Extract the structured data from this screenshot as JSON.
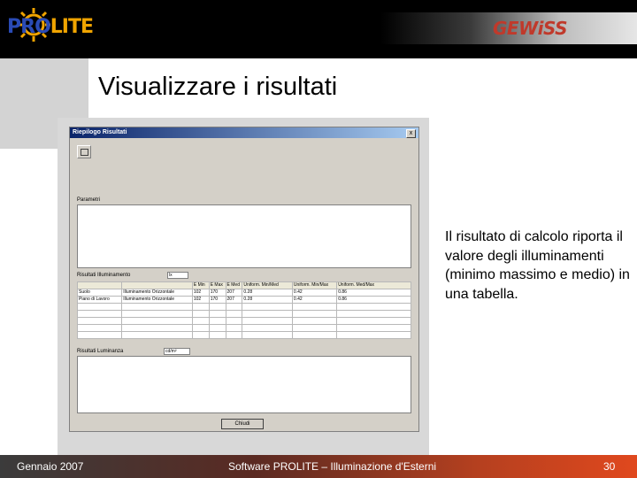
{
  "header": {
    "brand_left_pro": "PRO",
    "brand_left_lite": "LITE",
    "brand_right": "GEWiSS"
  },
  "slide": {
    "title": "Visualizzare i risultati",
    "description": "Il risultato di calcolo riporta il valore degli illuminamenti (minimo massimo e medio) in una tabella."
  },
  "window": {
    "title": "Riepilogo Risultati",
    "close_glyph": "x",
    "group1_label": "Parametri",
    "group2_label": "Risultati Illuminamento",
    "group2_field": "lx",
    "group3_label": "Risultati Luminanza",
    "group3_field": "cd/m²",
    "close_button": "Chiudi",
    "table": {
      "headers": [
        "",
        "",
        "E Min",
        "E Max",
        "E Med",
        "Uniform. Min/Med",
        "Uniform. Min/Max",
        "Uniform. Med/Max"
      ],
      "rows": [
        [
          "Suolo",
          "Illuminamento Orizzontale",
          "102",
          "170",
          "207",
          "0.28",
          "0.42",
          "0.86"
        ],
        [
          "Piano di Lavoro",
          "Illuminamento Orizzontale",
          "102",
          "170",
          "207",
          "0.28",
          "0.42",
          "0.86"
        ]
      ]
    }
  },
  "footer": {
    "date": "Gennaio 2007",
    "center": "Software PROLITE – Illuminazione d'Esterni",
    "page": "30"
  },
  "colors": {
    "footer_gradient_end": "#e0481e",
    "prolite_blue": "#2a4bb6",
    "prolite_orange": "#f0a400",
    "gewiss_red": "#c0392b",
    "window_title_blue": "#0a246a"
  }
}
